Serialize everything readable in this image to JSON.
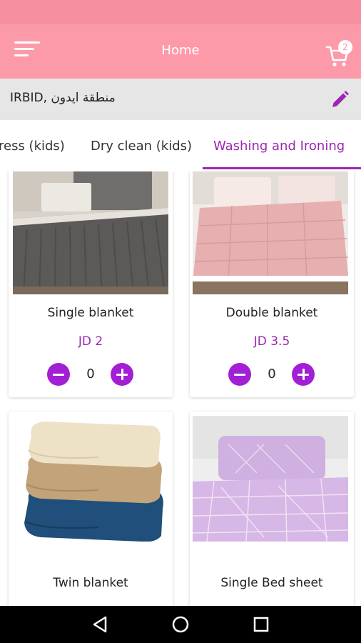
{
  "app": {
    "title": "Home",
    "cart_count": "2",
    "colors": {
      "app_bar": "#fc9aaa",
      "status_bar": "#f58fa0",
      "accent": "#9c27b0",
      "qty_button": "#a21fd6"
    }
  },
  "location": {
    "text": "IRBID, منطقة ايدون",
    "edit_icon": "pencil-icon"
  },
  "tabs": [
    {
      "label": "ress (kids)"
    },
    {
      "label": "Dry clean (kids)"
    },
    {
      "label": "Washing and Ironing",
      "active": true
    }
  ],
  "products": [
    {
      "name": "Single blanket",
      "price": "JD 2",
      "qty": "0"
    },
    {
      "name": "Double  blanket",
      "price": "JD 3.5",
      "qty": "0"
    },
    {
      "name": "Twin blanket"
    },
    {
      "name": "Single Bed sheet"
    }
  ],
  "icons": {
    "menu": "hamburger-menu-icon",
    "cart": "shopping-cart-icon",
    "minus": "minus-circle-icon",
    "plus": "plus-circle-icon",
    "back": "back-triangle-icon",
    "home": "home-circle-icon",
    "recents": "recents-square-icon"
  }
}
